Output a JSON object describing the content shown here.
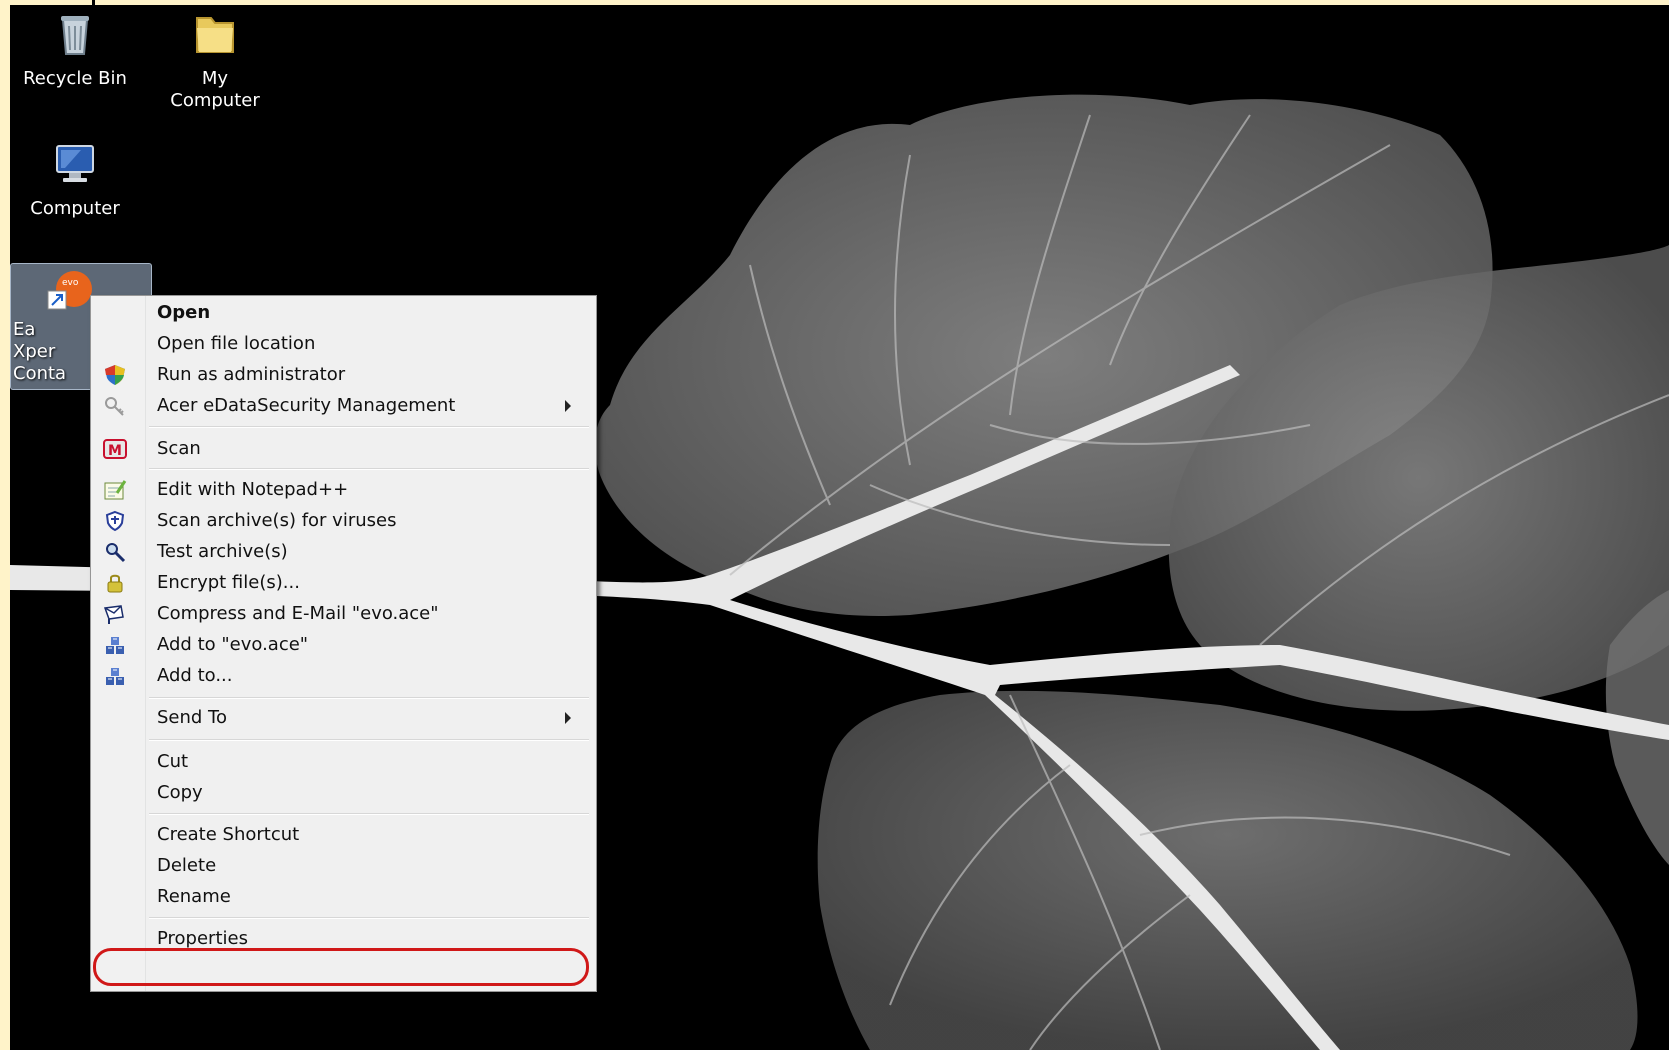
{
  "desktop": {
    "icons": [
      {
        "label": "Recycle Bin",
        "icon": "recycle-bin-icon"
      },
      {
        "label": "My Computer",
        "icon": "folder-icon"
      },
      {
        "label": "Computer",
        "icon": "computer-monitor-icon"
      }
    ],
    "selected_icon": {
      "label": "Ea\nXper\nConta",
      "icon": "evo-shortcut-icon"
    }
  },
  "context_menu": {
    "items": [
      {
        "label": "Open",
        "bold": true,
        "icon": ""
      },
      {
        "label": "Open file location",
        "icon": ""
      },
      {
        "label": "Run as administrator",
        "icon": "shield-icon"
      },
      {
        "label": "Acer eDataSecurity Management",
        "icon": "key-icon",
        "submenu": true
      },
      {
        "label": "Scan",
        "icon": "mcafee-icon"
      },
      {
        "label": "Edit with Notepad++",
        "icon": "notepad-icon"
      },
      {
        "label": "Scan archive(s) for viruses",
        "icon": "virus-shield-icon"
      },
      {
        "label": "Test archive(s)",
        "icon": "magnifier-icon"
      },
      {
        "label": "Encrypt file(s)...",
        "icon": "lock-icon"
      },
      {
        "label": "Compress and E-Mail \"evo.ace\"",
        "icon": "mail-compress-icon"
      },
      {
        "label": "Add to \"evo.ace\"",
        "icon": "archive-add-icon"
      },
      {
        "label": "Add to...",
        "icon": "archive-add-icon"
      },
      {
        "label": "Send To",
        "icon": "",
        "submenu": true
      },
      {
        "label": "Cut",
        "icon": ""
      },
      {
        "label": "Copy",
        "icon": ""
      },
      {
        "label": "Create Shortcut",
        "icon": ""
      },
      {
        "label": "Delete",
        "icon": ""
      },
      {
        "label": "Rename",
        "icon": ""
      },
      {
        "label": "Properties",
        "icon": "",
        "highlighted": true
      }
    ],
    "highlight_color": "#d01818"
  },
  "colors": {
    "desktop_bg": "#000000",
    "frame_bg": "#fff3c9",
    "menu_bg": "#f0f0f0"
  }
}
